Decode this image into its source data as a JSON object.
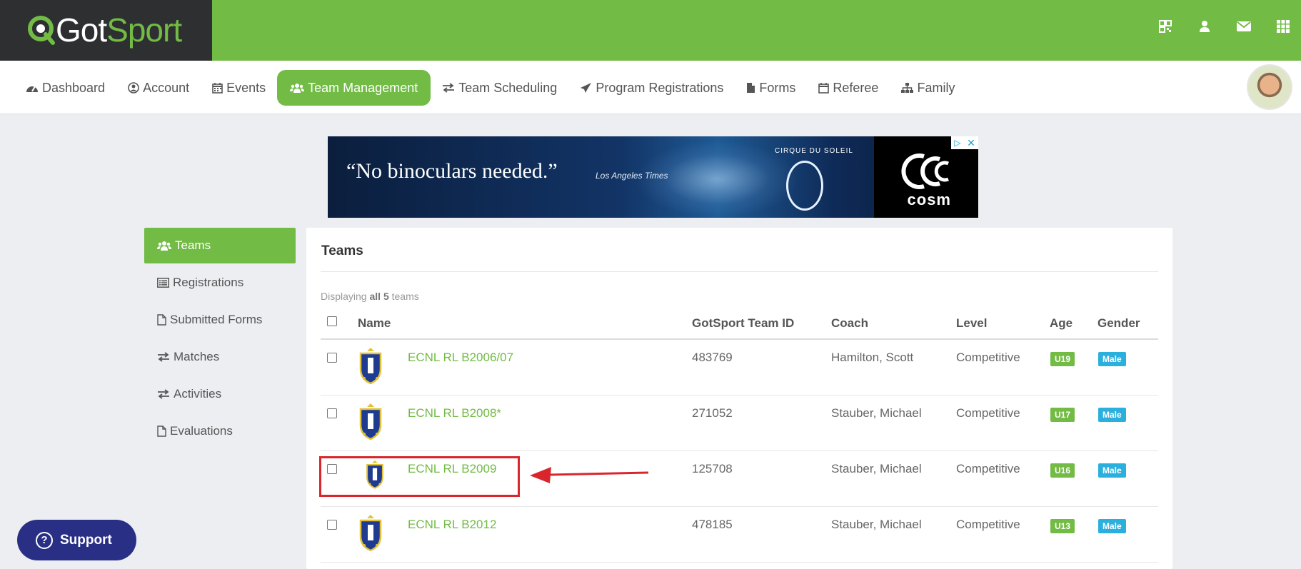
{
  "brand": {
    "got": "Got",
    "sport": "Sport"
  },
  "topbar": {
    "icons": [
      "qr-code-icon",
      "user-icon",
      "envelope-icon",
      "grid-icon"
    ]
  },
  "nav": {
    "items": [
      {
        "label": "Dashboard",
        "icon": "dashboard-icon"
      },
      {
        "label": "Account",
        "icon": "user-circle-icon"
      },
      {
        "label": "Events",
        "icon": "calendar-icon"
      },
      {
        "label": "Team Management",
        "icon": "users-icon",
        "active": true
      },
      {
        "label": "Team Scheduling",
        "icon": "exchange-icon"
      },
      {
        "label": "Program Registrations",
        "icon": "paper-plane-icon"
      },
      {
        "label": "Forms",
        "icon": "file-icon"
      },
      {
        "label": "Referee",
        "icon": "calendar-outline-icon"
      },
      {
        "label": "Family",
        "icon": "sitemap-icon"
      }
    ]
  },
  "ad": {
    "quote": "“No binoculars needed.”",
    "source": "Los Angeles Times",
    "brand": "CIRQUE DU SOLEIL",
    "logo": "cosm"
  },
  "sidebar": {
    "items": [
      {
        "label": "Teams",
        "icon": "users-icon",
        "active": true
      },
      {
        "label": "Registrations",
        "icon": "list-icon"
      },
      {
        "label": "Submitted Forms",
        "icon": "file-icon"
      },
      {
        "label": "Matches",
        "icon": "exchange-icon"
      },
      {
        "label": "Activities",
        "icon": "exchange-icon"
      },
      {
        "label": "Evaluations",
        "icon": "file-icon"
      }
    ]
  },
  "panel": {
    "title": "Teams",
    "displaying_prefix": "Displaying",
    "displaying_all": "all 5",
    "displaying_suffix": "teams",
    "columns": [
      "Name",
      "GotSport Team ID",
      "Coach",
      "Level",
      "Age",
      "Gender"
    ],
    "rows": [
      {
        "name": "ECNL RL B2006/07",
        "id": "483769",
        "coach": "Hamilton, Scott",
        "level": "Competitive",
        "age": "U19",
        "gender": "Male"
      },
      {
        "name": "ECNL RL B2008*",
        "id": "271052",
        "coach": "Stauber, Michael",
        "level": "Competitive",
        "age": "U17",
        "gender": "Male"
      },
      {
        "name": "ECNL RL B2009",
        "id": "125708",
        "coach": "Stauber, Michael",
        "level": "Competitive",
        "age": "U16",
        "gender": "Male"
      },
      {
        "name": "ECNL RL B2012",
        "id": "478185",
        "coach": "Stauber, Michael",
        "level": "Competitive",
        "age": "U13",
        "gender": "Male"
      }
    ]
  },
  "support": {
    "label": "Support"
  },
  "colors": {
    "brand_green": "#72bb45",
    "dark": "#2d2f31",
    "support_blue": "#2a2f86",
    "gender_blue": "#2bb0de",
    "annotation_red": "#d9262c"
  }
}
